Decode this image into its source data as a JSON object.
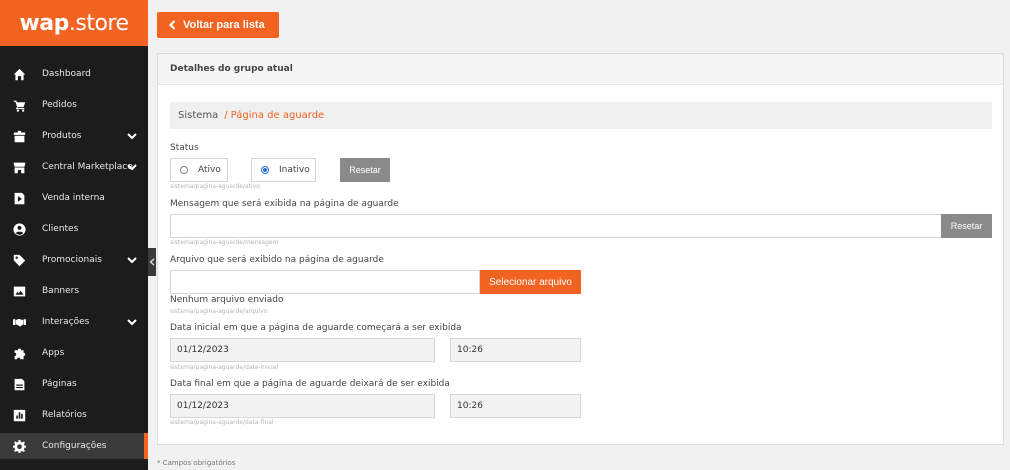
{
  "brand": {
    "logo_part1": "wap",
    "logo_part2": ".store"
  },
  "sidebar": {
    "items": [
      {
        "label": "Dashboard",
        "icon": "home-icon"
      },
      {
        "label": "Pedidos",
        "icon": "cart-icon"
      },
      {
        "label": "Produtos",
        "icon": "box-icon"
      },
      {
        "label": "Central Marketplace",
        "icon": "store-icon"
      },
      {
        "label": "Venda interna",
        "icon": "play-tag-icon"
      },
      {
        "label": "Clientes",
        "icon": "user-icon"
      },
      {
        "label": "Promocionais",
        "icon": "tag-icon"
      },
      {
        "label": "Banners",
        "icon": "image-icon"
      },
      {
        "label": "Interações",
        "icon": "handshake-icon"
      },
      {
        "label": "Apps",
        "icon": "puzzle-icon"
      },
      {
        "label": "Páginas",
        "icon": "page-icon"
      },
      {
        "label": "Relatórios",
        "icon": "chart-icon"
      },
      {
        "label": "Configurações",
        "icon": "gear-icon"
      }
    ]
  },
  "toolbar": {
    "back_label": "Voltar para lista"
  },
  "panel": {
    "title": "Detalhes do grupo atual",
    "breadcrumb": {
      "parent": "Sistema",
      "separator": "/",
      "current": "Página de aguarde"
    }
  },
  "form": {
    "status": {
      "label": "Status",
      "option_active": "Ativo",
      "option_inactive": "Inativo",
      "reset_label": "Resetar",
      "hint": "sistema/pagina-aguarde/ativo"
    },
    "message": {
      "label": "Mensagem que será exibida na página de aguarde",
      "value": "",
      "reset_label": "Resetar",
      "hint": "sistema/pagina-aguarde/mensagem"
    },
    "file": {
      "label": "Arquivo que será exibido na página de aguarde",
      "value": "",
      "button_label": "Selecionar arquivo",
      "status": "Nenhum arquivo enviado",
      "hint": "sistema/pagina-aguarde/arquivo"
    },
    "start": {
      "label": "Data inicial em que a página de aguarde começará a ser exibida",
      "date": "01/12/2023",
      "time": "10:26",
      "hint": "sistema/pagina-aguarde/data-inicial"
    },
    "end": {
      "label": "Data final em que a página de aguarde deixará de ser exibida",
      "date": "01/12/2023",
      "time": "10:26",
      "hint": "sistema/pagina-aguarde/data-final"
    }
  },
  "footer": {
    "required_note": "* Campos obrigatórios"
  },
  "colors": {
    "accent": "#f26322",
    "sidebar_bg": "#1c1c1c",
    "radio_selected": "#2a6fdb"
  }
}
